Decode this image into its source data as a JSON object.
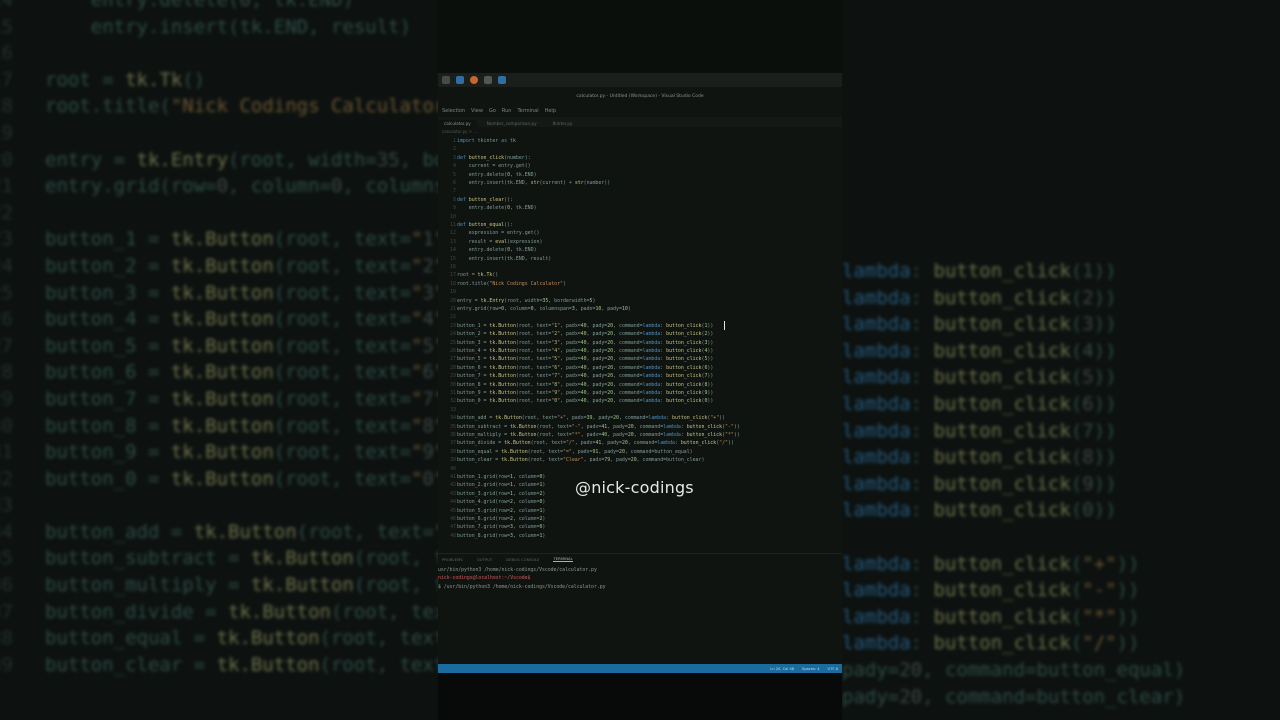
{
  "window": {
    "title": "calculator.py - Untitled (Workspace) - Visual Studio Code",
    "menu": [
      "Selection",
      "View",
      "Go",
      "Run",
      "Terminal",
      "Help"
    ],
    "tabs": [
      {
        "label": "calculator.py",
        "active": true
      },
      {
        "label": "Number_comparison.py",
        "active": false
      },
      {
        "label": "tkinter.py",
        "active": false
      }
    ],
    "breadcrumb": "calculator.py > ..."
  },
  "code_lines": [
    {
      "n": "1",
      "t": "import tkinter as tk"
    },
    {
      "n": "2",
      "t": ""
    },
    {
      "n": "3",
      "t": "def button_click(number):"
    },
    {
      "n": "4",
      "t": "    current = entry.get()"
    },
    {
      "n": "5",
      "t": "    entry.delete(0, tk.END)"
    },
    {
      "n": "6",
      "t": "    entry.insert(tk.END, str(current) + str(number))"
    },
    {
      "n": "7",
      "t": ""
    },
    {
      "n": "8",
      "t": "def button_clear():"
    },
    {
      "n": "9",
      "t": "    entry.delete(0, tk.END)"
    },
    {
      "n": "10",
      "t": ""
    },
    {
      "n": "11",
      "t": "def button_equal():"
    },
    {
      "n": "12",
      "t": "    expression = entry.get()"
    },
    {
      "n": "13",
      "t": "    result = eval(expression)"
    },
    {
      "n": "14",
      "t": "    entry.delete(0, tk.END)"
    },
    {
      "n": "15",
      "t": "    entry.insert(tk.END, result)"
    },
    {
      "n": "16",
      "t": ""
    },
    {
      "n": "17",
      "t": "root = tk.Tk()"
    },
    {
      "n": "18",
      "t": "root.title(\"Nick Codings Calculator\")"
    },
    {
      "n": "19",
      "t": ""
    },
    {
      "n": "20",
      "t": "entry = tk.Entry(root, width=35, borderwidth=5)"
    },
    {
      "n": "21",
      "t": "entry.grid(row=0, column=0, columnspan=3, padx=10, pady=10)"
    },
    {
      "n": "22",
      "t": ""
    },
    {
      "n": "23",
      "t": "button_1 = tk.Button(root, text=\"1\", padx=40, pady=20, command=lambda: button_click(1))"
    },
    {
      "n": "24",
      "t": "button_2 = tk.Button(root, text=\"2\", padx=40, pady=20, command=lambda: button_click(2))"
    },
    {
      "n": "25",
      "t": "button_3 = tk.Button(root, text=\"3\", padx=40, pady=20, command=lambda: button_click(3))"
    },
    {
      "n": "26",
      "t": "button_4 = tk.Button(root, text=\"4\", padx=40, pady=20, command=lambda: button_click(4))"
    },
    {
      "n": "27",
      "t": "button_5 = tk.Button(root, text=\"5\", padx=40, pady=20, command=lambda: button_click(5))"
    },
    {
      "n": "28",
      "t": "button_6 = tk.Button(root, text=\"6\", padx=40, pady=20, command=lambda: button_click(6))"
    },
    {
      "n": "29",
      "t": "button_7 = tk.Button(root, text=\"7\", padx=40, pady=20, command=lambda: button_click(7))"
    },
    {
      "n": "30",
      "t": "button_8 = tk.Button(root, text=\"8\", padx=40, pady=20, command=lambda: button_click(8))"
    },
    {
      "n": "31",
      "t": "button_9 = tk.Button(root, text=\"9\", padx=40, pady=20, command=lambda: button_click(9))"
    },
    {
      "n": "32",
      "t": "button_0 = tk.Button(root, text=\"0\", padx=40, pady=20, command=lambda: button_click(0))"
    },
    {
      "n": "33",
      "t": ""
    },
    {
      "n": "34",
      "t": "button_add = tk.Button(root, text=\"+\", padx=39, pady=20, command=lambda: button_click(\"+\"))"
    },
    {
      "n": "35",
      "t": "button_subtract = tk.Button(root, text=\"-\", padx=41, pady=20, command=lambda: button_click(\"-\"))"
    },
    {
      "n": "36",
      "t": "button_multiply = tk.Button(root, text=\"*\", padx=40, pady=20, command=lambda: button_click(\"*\"))"
    },
    {
      "n": "37",
      "t": "button_divide = tk.Button(root, text=\"/\", padx=41, pady=20, command=lambda: button_click(\"/\"))"
    },
    {
      "n": "38",
      "t": "button_equal = tk.Button(root, text=\"=\", padx=91, pady=20, command=button_equal)"
    },
    {
      "n": "39",
      "t": "button_clear = tk.Button(root, text=\"Clear\", padx=79, pady=20, command=button_clear)"
    },
    {
      "n": "40",
      "t": ""
    },
    {
      "n": "41",
      "t": "button_1.grid(row=1, column=0)"
    },
    {
      "n": "42",
      "t": "button_2.grid(row=1, column=1)"
    },
    {
      "n": "43",
      "t": "button_3.grid(row=1, column=2)"
    },
    {
      "n": "44",
      "t": "button_4.grid(row=2, column=0)"
    },
    {
      "n": "45",
      "t": "button_5.grid(row=2, column=1)"
    },
    {
      "n": "46",
      "t": "button_6.grid(row=2, column=2)"
    },
    {
      "n": "47",
      "t": "button_7.grid(row=3, column=0)"
    },
    {
      "n": "48",
      "t": "button_8.grid(row=3, column=1)"
    }
  ],
  "watermark": "@nick-codings",
  "panel": {
    "tabs": [
      "PROBLEMS",
      "OUTPUT",
      "DEBUG CONSOLE",
      "TERMINAL"
    ],
    "active": "TERMINAL",
    "terminal_lines": [
      "usr/bin/python3 /home/nick-codings/Vscode/calculator.py",
      "nick-codings@localhost:~/Vscode$",
      "$ /usr/bin/python3 /home/nick-codings/Vscode/calculator.py"
    ]
  },
  "statusbar": {
    "position": "Ln 20, Col 48",
    "spaces": "Spaces: 4",
    "encoding": "UTF-8"
  },
  "colors": {
    "keyword": "#4d8ec0",
    "string": "#c08a55",
    "function": "#c8c486",
    "statusbar": "#1a6b9e"
  }
}
